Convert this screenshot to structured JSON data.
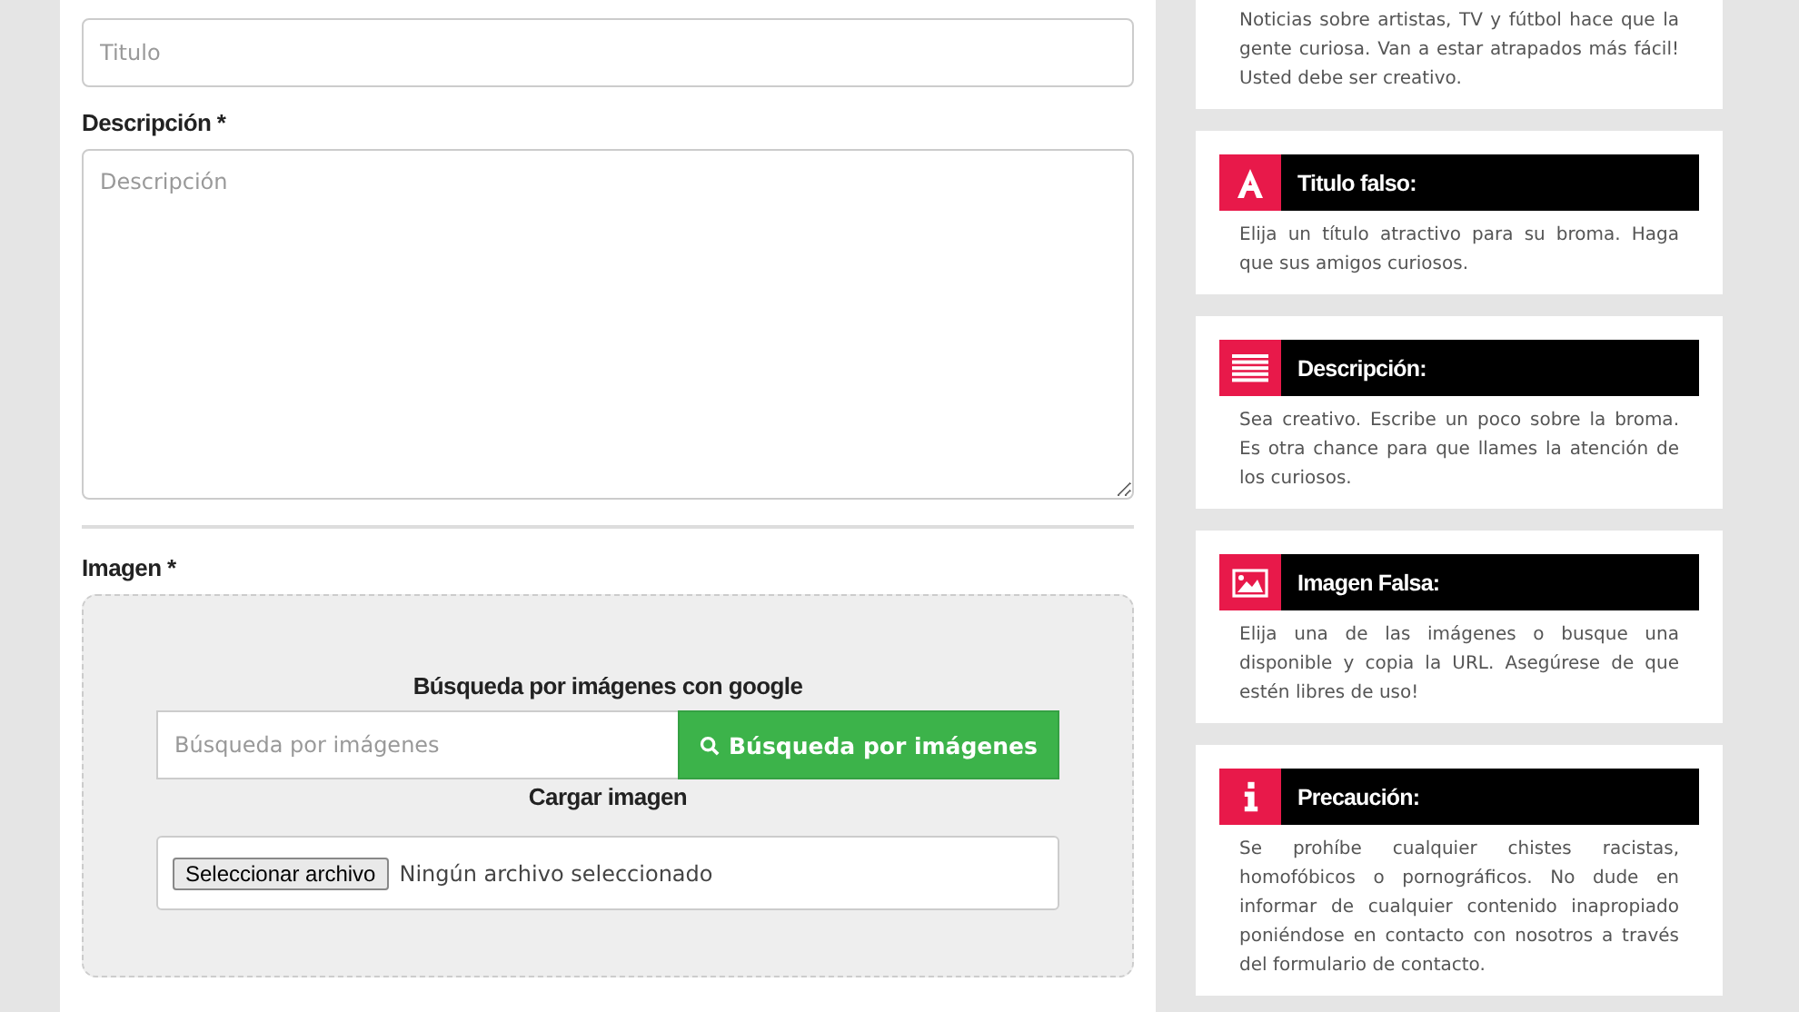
{
  "form": {
    "title_field": {
      "placeholder": "Titulo"
    },
    "description": {
      "label": "Descripción *",
      "placeholder": "Descripción"
    },
    "image": {
      "label": "Imagen *",
      "search_heading": "Búsqueda por imágenes con google",
      "search_field": {
        "placeholder": "Búsqueda por imágenes"
      },
      "search_button": "Búsqueda por imágenes",
      "upload_heading": "Cargar imagen",
      "file_button": "Seleccionar archivo",
      "file_status": "Ningún archivo seleccionado"
    }
  },
  "sidebar": {
    "cards": [
      {
        "kind": "note",
        "text": "Noticias sobre artistas, TV y fútbol hace que la gente curiosa. Van a estar atrapados más fácil! Usted debe ser creativo."
      },
      {
        "kind": "letter",
        "title": "Titulo falso:",
        "text": "Elija un título atractivo para su broma. Haga que sus amigos curiosos."
      },
      {
        "kind": "lines",
        "title": "Descripción:",
        "text": "Sea creativo. Escribe un poco sobre la broma. Es otra chance para que llames la atención de los curiosos."
      },
      {
        "kind": "picture",
        "title": "Imagen Falsa:",
        "text": "Elija una de las imágenes o busque una disponible y copia la URL. Asegúrese de que estén libres de uso!"
      },
      {
        "kind": "info",
        "title": "Precaución:",
        "text": "Se prohíbe cualquier chistes racistas, homofóbicos o pornográficos. No dude en informar de cualquier contenido inapropiado poniéndose en contacto con nosotros a través del formulario de contacto."
      }
    ]
  }
}
